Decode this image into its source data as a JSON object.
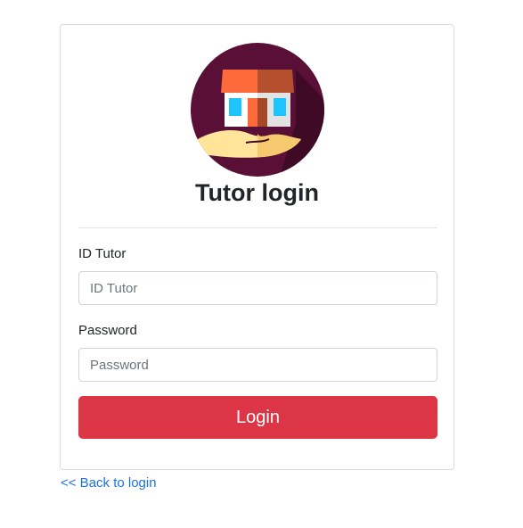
{
  "login": {
    "logo_icon": "house-in-hand-icon",
    "title": "Tutor login",
    "id_label": "ID Tutor",
    "id_placeholder": "ID Tutor",
    "id_value": "",
    "password_label": "Password",
    "password_placeholder": "Password",
    "password_value": "",
    "login_button": "Login",
    "back_link": "<< Back to login"
  },
  "colors": {
    "button": "#dc3545",
    "link": "#1a73d9",
    "logo_background": "#5a0f36"
  }
}
